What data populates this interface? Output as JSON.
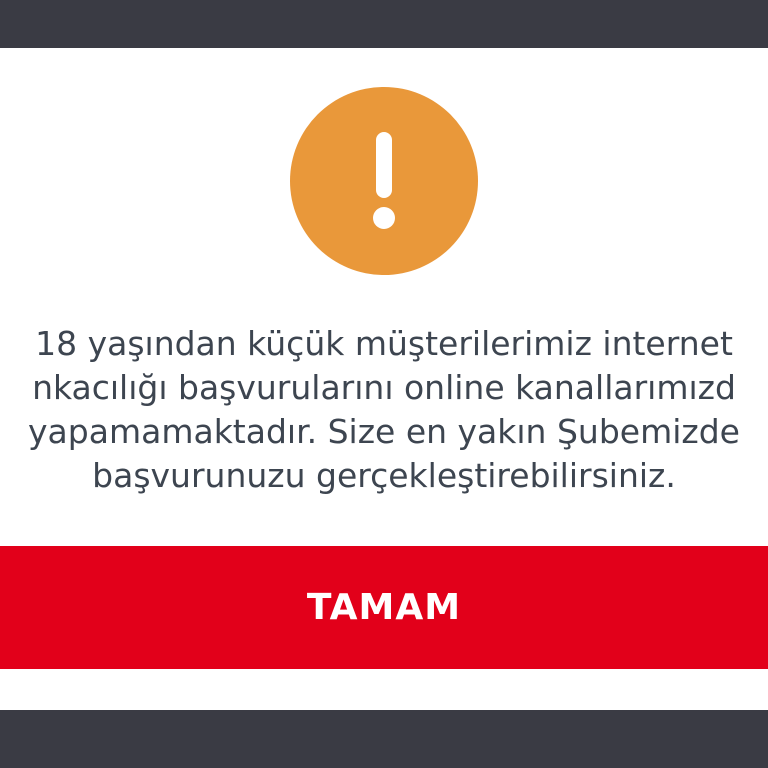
{
  "dialog": {
    "icon": "exclamation-icon",
    "colors": {
      "icon_background": "#e9983a",
      "button_background": "#e2001a",
      "text": "#3d4550",
      "overlay": "#3a3b44"
    },
    "message_lines": [
      "18 yaşından küçük müşterilerimiz internet",
      "nkacılığı başvurularını online kanallarımızd",
      "yapamamaktadır. Size en yakın Şubemizde",
      "başvurunuzu gerçekleştirebilirsiniz."
    ],
    "ok_label": "TAMAM"
  }
}
